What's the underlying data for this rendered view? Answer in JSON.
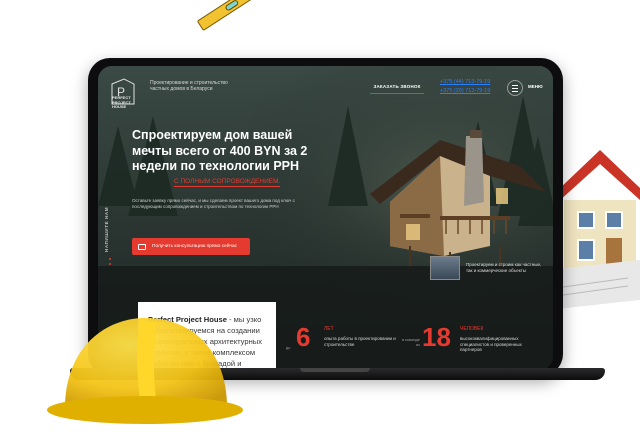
{
  "header": {
    "logo_text": [
      "PERFECT",
      "PROJECT",
      "HOUSE"
    ],
    "tagline": "Проектирование и строительство частных домов в Беларуси",
    "callback_label": "ЗАКАЗАТЬ ЗВОНОК",
    "phones": [
      "+375 (44) 713-79-19",
      "+375 (29) 713-79-19"
    ],
    "menu_label": "МЕНЮ"
  },
  "hero": {
    "title": "Спроектируем дом вашей мечты всего от 400 BYN за 2 недели по технологии PPH",
    "subtitle": "С ПОЛНЫМ СОПРОВОЖДЕНИЕМ.",
    "description": "Оставьте заявку прямо сейчас, и мы сделаем проект вашего дома под ключ с последующим сопровождением и строительством по технологии PPH",
    "cta_label": "Получить консультацию прямо сейчас",
    "vertical_label": "НАПИШИТЕ НАМ"
  },
  "objects": {
    "text": "Проектируем и строим как частные, так и коммерческие объекты"
  },
  "about": {
    "brand": "Perfect Project House",
    "text": " - мы узко специализируемся на создании индивидуальных архитектурных проектов, а также комплексом работ по ним с бригадой и"
  },
  "stats": [
    {
      "prefix": "до",
      "number": "6",
      "unit": "ЛЕТ",
      "description": "опыта работы в проектировании и строительстве"
    },
    {
      "prefix": "в команде их",
      "number": "18",
      "unit": "ЧЕЛОВЕК",
      "description": "высококвалифицированных специалистов и проверенных партнеров"
    }
  ],
  "colors": {
    "accent": "#e53a2f",
    "link": "#2d7ff9",
    "hat": "#f5c518"
  }
}
